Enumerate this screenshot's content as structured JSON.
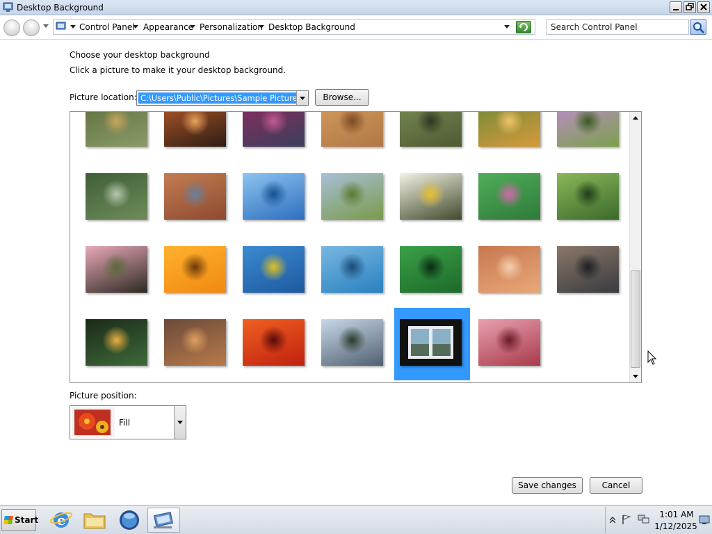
{
  "window": {
    "title": "Desktop Background"
  },
  "address": {
    "crumbs": [
      "Control Panel",
      "Appearance",
      "Personalization",
      "Desktop Background"
    ],
    "search_placeholder": "Search Control Panel"
  },
  "content": {
    "heading": "Choose your desktop background",
    "subheading": "Click a picture to make it your desktop background.",
    "location_label": "Picture location:",
    "location_value": "C:\\Users\\Public\\Pictures\\Sample Pictures",
    "browse_label": "Browse...",
    "position_label": "Picture position:",
    "position_value": "Fill",
    "save_label": "Save changes",
    "cancel_label": "Cancel"
  },
  "pictures": [
    {
      "name": "green-hills",
      "colors": [
        "#8a9b6a",
        "#5f6e3c",
        "#c6a65b"
      ]
    },
    {
      "name": "canyon-sunset",
      "colors": [
        "#2d1d14",
        "#b4582a",
        "#e9a25a"
      ]
    },
    {
      "name": "flower-field-mountains",
      "colors": [
        "#3b3f5c",
        "#8a2c5e",
        "#c05a92"
      ]
    },
    {
      "name": "sandstone-canyon",
      "colors": [
        "#b07845",
        "#d49a5e",
        "#7a4a25"
      ]
    },
    {
      "name": "forest-stream",
      "colors": [
        "#4e5a32",
        "#7a8a56",
        "#2d3720"
      ]
    },
    {
      "name": "autumn-trees",
      "colors": [
        "#d79a3a",
        "#6f8a3a",
        "#f0c36a"
      ]
    },
    {
      "name": "butterfly",
      "colors": [
        "#7aa04a",
        "#c08bd0",
        "#3a5a22"
      ]
    },
    {
      "name": "river-valley",
      "colors": [
        "#6e8c5a",
        "#3f5f36",
        "#b7c6b0"
      ]
    },
    {
      "name": "monument-valley",
      "colors": [
        "#8c4a30",
        "#c47d52",
        "#6a7f9b"
      ]
    },
    {
      "name": "blue-dock",
      "colors": [
        "#2d6fbf",
        "#8ec3f0",
        "#145090"
      ]
    },
    {
      "name": "grass-path",
      "colors": [
        "#7a9a4a",
        "#a8c0d8",
        "#5c7a30"
      ]
    },
    {
      "name": "white-flower",
      "colors": [
        "#3f4a2c",
        "#f4f1e4",
        "#e8c030"
      ]
    },
    {
      "name": "pink-flowers-leaves",
      "colors": [
        "#2f7a3a",
        "#4fae5a",
        "#d068a8"
      ]
    },
    {
      "name": "forest-path",
      "colors": [
        "#3a6a2a",
        "#8ab85a",
        "#1f3d18"
      ]
    },
    {
      "name": "pink-plumeria",
      "colors": [
        "#2c2a22",
        "#e9a9b8",
        "#5a6a3a"
      ]
    },
    {
      "name": "orange-daisies",
      "colors": [
        "#f08a10",
        "#ffb030",
        "#6a3a08"
      ]
    },
    {
      "name": "sea-turtle",
      "colors": [
        "#1d5aa0",
        "#3c8ad0",
        "#e0c020"
      ]
    },
    {
      "name": "whale-tail",
      "colors": [
        "#2a80c0",
        "#78b8e0",
        "#1a4a78"
      ]
    },
    {
      "name": "green-tulip-leaves",
      "colors": [
        "#1d6a2a",
        "#3aa048",
        "#0a2a10"
      ]
    },
    {
      "name": "desert-oryx",
      "colors": [
        "#e8a878",
        "#c87850",
        "#f6d0b0"
      ]
    },
    {
      "name": "rocks",
      "colors": [
        "#3a3a40",
        "#8a7868",
        "#1e1e24"
      ]
    },
    {
      "name": "toucan",
      "colors": [
        "#3f6a3a",
        "#1a2a18",
        "#e8b040"
      ]
    },
    {
      "name": "bare-trees-sunset",
      "colors": [
        "#b87a4a",
        "#6a4a3a",
        "#e0a060"
      ]
    },
    {
      "name": "red-tulips",
      "colors": [
        "#c02010",
        "#f06020",
        "#5a0a08"
      ]
    },
    {
      "name": "waterfall",
      "colors": [
        "#506070",
        "#c8d8e8",
        "#2a3a2a"
      ]
    },
    {
      "name": "window-view",
      "colors": [
        "#121212",
        "#8ab0c8",
        "#e8ecef"
      ]
    },
    {
      "name": "frosted-leaves",
      "colors": [
        "#a83a4a",
        "#e8a0b0",
        "#6a1a28"
      ]
    }
  ],
  "selected_picture": "window-view",
  "taskbar": {
    "start_label": "Start",
    "time": "1:01 AM",
    "date": "1/12/2025"
  }
}
